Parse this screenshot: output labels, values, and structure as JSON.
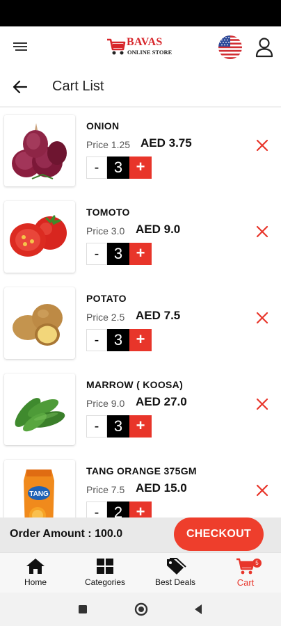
{
  "header": {
    "logo_title": "BAVAS",
    "logo_subtitle": "ONLINE STORE"
  },
  "title_bar": {
    "title": "Cart List"
  },
  "cart_items": [
    {
      "name": "ONION",
      "price_label": "Price 1.25",
      "total": "AED 3.75",
      "quantity": "3"
    },
    {
      "name": "TOMOTO",
      "price_label": "Price 3.0",
      "total": "AED 9.0",
      "quantity": "3"
    },
    {
      "name": "POTATO",
      "price_label": "Price 2.5",
      "total": "AED 7.5",
      "quantity": "3"
    },
    {
      "name": "MARROW ( KOOSA)",
      "price_label": "Price 9.0",
      "total": "AED 27.0",
      "quantity": "3"
    },
    {
      "name": "TANG ORANGE 375GM",
      "price_label": "Price 7.5",
      "total": "AED 15.0",
      "quantity": "2"
    }
  ],
  "qty_controls": {
    "minus": "-",
    "plus": "+"
  },
  "order": {
    "amount_label": "Order Amount : 100.0",
    "checkout_label": "CHECKOUT"
  },
  "bottom_nav": [
    {
      "label": "Home",
      "icon": "home-icon"
    },
    {
      "label": "Categories",
      "icon": "grid-icon"
    },
    {
      "label": "Best Deals",
      "icon": "tags-icon"
    },
    {
      "label": "Cart",
      "icon": "cart-icon",
      "badge": "5",
      "active": true
    }
  ],
  "colors": {
    "accent": "#e8352a",
    "checkout": "#ee3e2c",
    "qty_value_bg": "#000000",
    "order_bar_bg": "#e9e9e9"
  }
}
